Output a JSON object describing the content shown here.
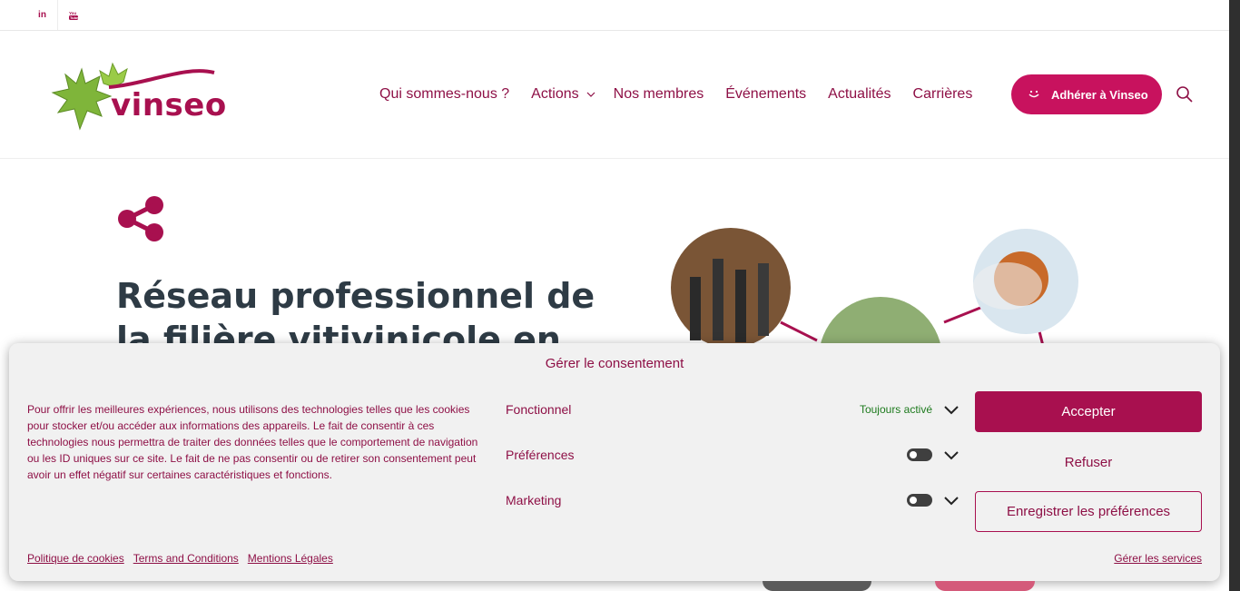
{
  "topbar": {
    "linkedin_label": "in",
    "youtube_label": "You Tube"
  },
  "logo": {
    "text": "vinseo"
  },
  "nav": {
    "items": [
      {
        "label": "Qui sommes-nous ?"
      },
      {
        "label": "Actions"
      },
      {
        "label": "Nos membres"
      },
      {
        "label": "Événements"
      },
      {
        "label": "Actualités"
      },
      {
        "label": "Carrières"
      }
    ],
    "cta_label": "Adhérer à Vinseo"
  },
  "hero": {
    "title": "Réseau professionnel de la filière vitivinicole en"
  },
  "consent": {
    "title": "Gérer le consentement",
    "description": "Pour offrir les meilleures expériences, nous utilisons des technologies telles que les cookies pour stocker et/ou accéder aux informations des appareils. Le fait de consentir à ces technologies nous permettra de traiter des données telles que le comportement de navigation ou les ID uniques sur ce site. Le fait de ne pas consentir ou de retirer son consentement peut avoir un effet négatif sur certaines caractéristiques et fonctions.",
    "categories": [
      {
        "name": "Fonctionnel",
        "status": "Toujours activé"
      },
      {
        "name": "Préférences",
        "enabled": false
      },
      {
        "name": "Marketing",
        "enabled": false
      }
    ],
    "accept_label": "Accepter",
    "refuse_label": "Refuser",
    "save_label": "Enregistrer les préférences",
    "links": [
      "Politique de cookies",
      "Terms and Conditions",
      "Mentions Légales"
    ],
    "manage_services": "Gérer les services"
  },
  "colors": {
    "brand": "#a8104f",
    "cta": "#c8125e",
    "text_dark": "#2e3b45",
    "active_green": "#1d7a1d"
  }
}
